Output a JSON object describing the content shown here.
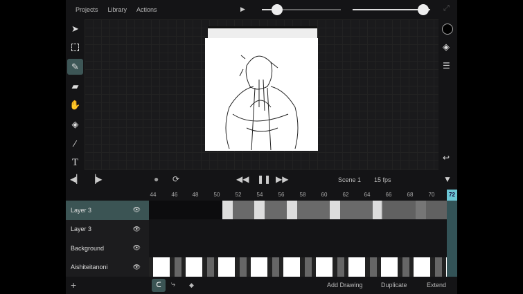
{
  "menu": {
    "projects": "Projects",
    "library": "Library",
    "actions": "Actions"
  },
  "sliders": {
    "brush_size": 0.15,
    "opacity": 1.0
  },
  "controls": {
    "scene": "Scene 1",
    "fps": "15 fps"
  },
  "ruler": {
    "ticks": [
      "44",
      "46",
      "48",
      "50",
      "52",
      "54",
      "56",
      "58",
      "60",
      "62",
      "64",
      "66",
      "68",
      "70"
    ],
    "current": "72"
  },
  "layers": [
    {
      "name": "Layer 3",
      "selected": true
    },
    {
      "name": "Layer 3"
    },
    {
      "name": "Background"
    },
    {
      "name": "Aishiteitanoni"
    }
  ],
  "bottom": {
    "add_drawing": "Add Drawing",
    "duplicate": "Duplicate",
    "extend": "Extend"
  }
}
